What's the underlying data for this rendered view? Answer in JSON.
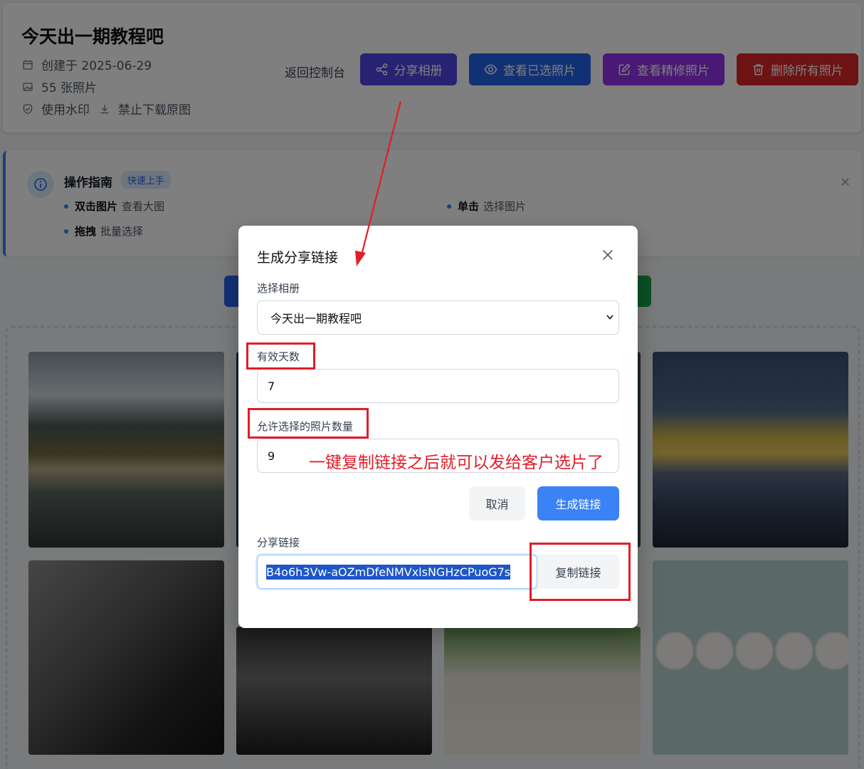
{
  "header": {
    "title": "今天出一期教程吧",
    "created": "创建于 2025-06-29",
    "photo_count": "55 张照片",
    "watermark": "使用水印",
    "download": "禁止下载原图",
    "back": "返回控制台",
    "buttons": {
      "share": "分享相册",
      "view_selected": "查看已选照片",
      "view_retouched": "查看精修照片",
      "delete_all": "删除所有照片"
    },
    "colors": {
      "share": "#4f46e5",
      "view_selected": "#2563eb",
      "view_retouched": "#9333ea",
      "delete_all": "#dc2626"
    }
  },
  "guide": {
    "title": "操作指南",
    "badge": "快速上手",
    "items": [
      {
        "action": "双击图片",
        "desc": "查看大图"
      },
      {
        "action": "拖拽",
        "desc": "批量选择"
      },
      {
        "action": "单击",
        "desc": "选择图片"
      }
    ]
  },
  "modal": {
    "title": "生成分享链接",
    "album_label": "选择相册",
    "album_value": "今天出一期教程吧",
    "days_label": "有效天数",
    "days_value": "7",
    "count_label": "允许选择的照片数量",
    "count_value": "9",
    "cancel": "取消",
    "generate": "生成链接",
    "link_label": "分享链接",
    "link_value": "B4o6h3Vw-aOZmDfeNMVxlsNGHzCPuoG7s",
    "copy": "复制链接"
  },
  "annotation": "一键复制链接之后就可以发给客户选片了",
  "icons": [
    "calendar-icon",
    "image-icon",
    "shield-icon",
    "download-icon",
    "share-icon",
    "eye-icon",
    "edit-icon",
    "trash-icon",
    "info-icon",
    "close-icon",
    "chevron-down-icon"
  ]
}
